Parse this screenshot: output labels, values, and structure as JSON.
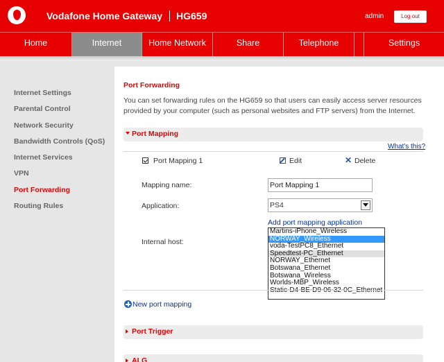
{
  "header": {
    "title": "Vodafone Home Gateway",
    "model": "HG659",
    "user": "admin",
    "logout_label": "Log out"
  },
  "nav": {
    "items": [
      {
        "label": "Home"
      },
      {
        "label": "Internet"
      },
      {
        "label": "Home Network"
      },
      {
        "label": "Share"
      },
      {
        "label": "Telephone"
      },
      {
        "label": "Settings"
      }
    ],
    "active": "Internet"
  },
  "sidebar": {
    "items": [
      {
        "label": "Internet Settings"
      },
      {
        "label": "Parental Control"
      },
      {
        "label": "Network Security"
      },
      {
        "label": "Bandwidth Controls (QoS)"
      },
      {
        "label": "Internet Services"
      },
      {
        "label": "VPN"
      },
      {
        "label": "Port Forwarding"
      },
      {
        "label": "Routing Rules"
      }
    ],
    "active": "Port Forwarding"
  },
  "main": {
    "title": "Port Forwarding",
    "intro": "You can set forwarding rules on the HG659 so that users can easily access server resources provided by your computer (such as personal websites and FTP servers) from the Internet.",
    "port_mapping_section": "Port Mapping",
    "whats_this": "What's this?",
    "entry": {
      "name": "Port Mapping 1",
      "checked": true,
      "edit_label": "Edit",
      "delete_label": "Delete"
    },
    "form": {
      "mapping_name_label": "Mapping name:",
      "mapping_name_value": "Port Mapping 1",
      "application_label": "Application:",
      "application_value": "PS4",
      "add_app_link": "Add port mapping application",
      "internal_host_label": "Internal host:",
      "host_options": [
        "Martins-iPhone_Wireless",
        "NORWAY_Wireless",
        "voda-TestPC8_Ethernet",
        "Speedtest-PC_Ethernet",
        "NORWAY_Ethernet",
        "Botswana_Ethernet",
        "Botswana_Wireless",
        "Worlds-MBP_Wireless",
        "Static-D4-BE-D9-06-32-0C_Ethernet"
      ],
      "host_selected": "NORWAY_Wireless",
      "host_hovered": "Speedtest-PC_Ethernet"
    },
    "new_mapping_link": "New port mapping",
    "port_trigger_section": "Port Trigger",
    "alg_section": "ALG"
  },
  "colors": {
    "brand_red": "#e60000",
    "active_tab": "#8c8c8c",
    "link_blue": "#0033aa",
    "selection_blue": "#3399ff"
  }
}
